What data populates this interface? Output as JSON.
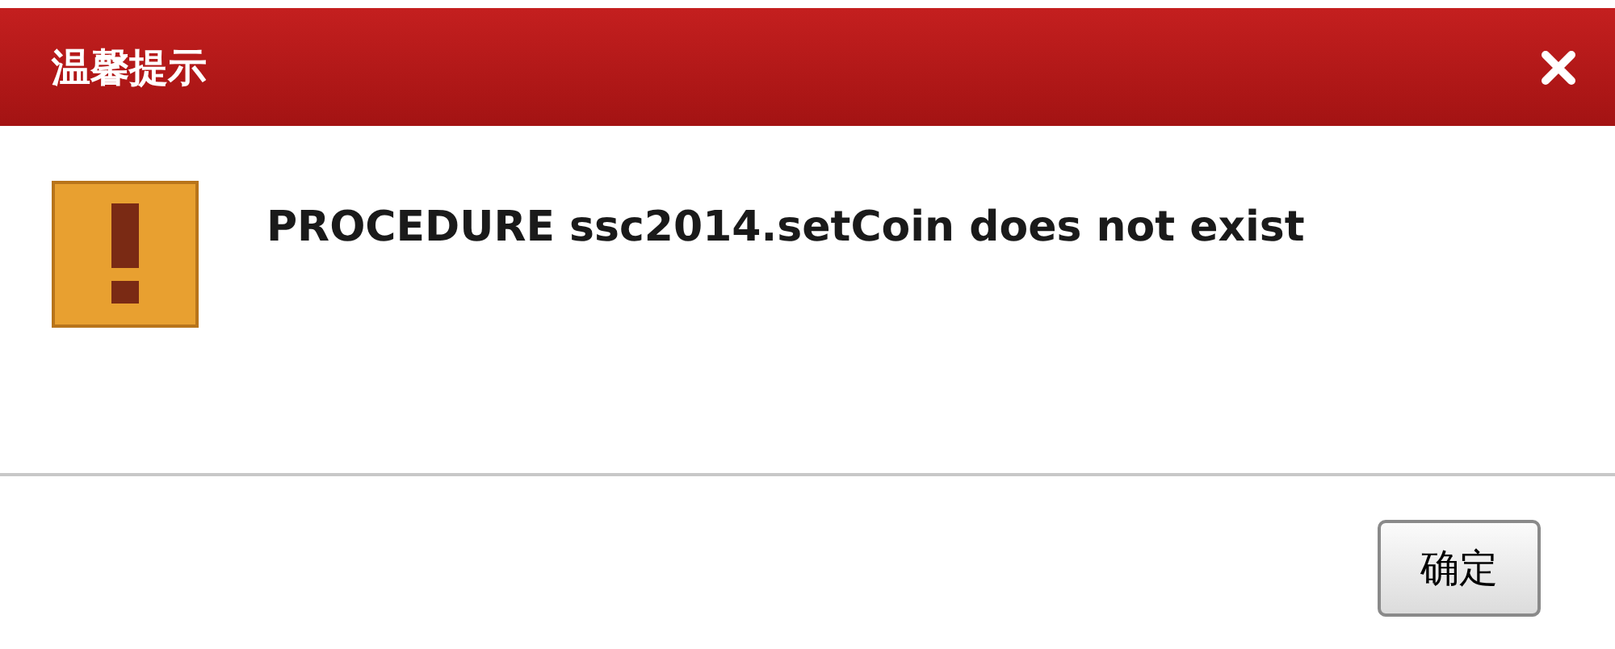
{
  "dialog": {
    "title": "温馨提示",
    "message": "PROCEDURE ssc2014.setCoin does not exist"
  },
  "buttons": [
    "确定"
  ]
}
